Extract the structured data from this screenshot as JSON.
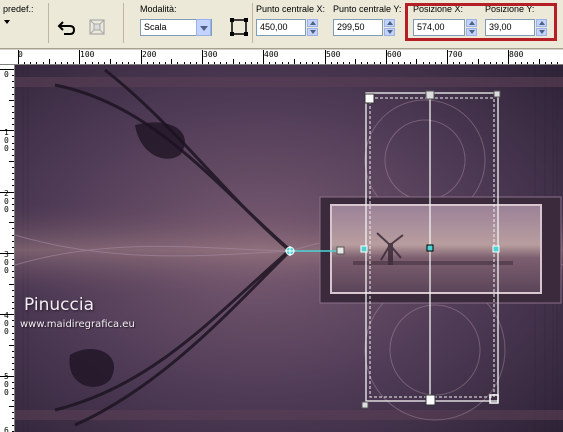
{
  "toolbar": {
    "preset_label": "predef.:",
    "mode_label": "Modalità:",
    "mode_value": "Scala",
    "center_x_label": "Punto centrale X:",
    "center_x_value": "450,00",
    "center_y_label": "Punto centrale Y:",
    "center_y_value": "299,50",
    "pos_x_label": "Posizione X:",
    "pos_x_value": "574,00",
    "pos_y_label": "Posizione Y:",
    "pos_y_value": "39,00",
    "highlight_color": "#b41e24"
  },
  "ruler": {
    "h_labels": [
      "0",
      "100",
      "200",
      "300",
      "400",
      "500",
      "600",
      "700",
      "800"
    ],
    "v_labels": [
      "0",
      "100",
      "200",
      "300",
      "400",
      "500",
      "600"
    ]
  },
  "canvas": {
    "watermark_title": "Pinuccia",
    "watermark_url": "www.maidiregrafica.eu",
    "icons": [
      "pick-tool-handle",
      "center-handle",
      "rotation-handle"
    ]
  }
}
